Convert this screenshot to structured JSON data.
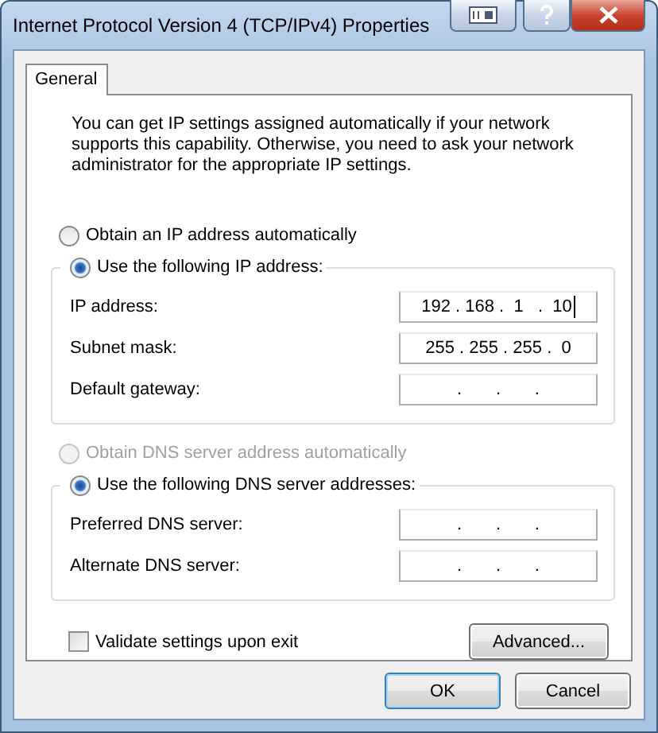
{
  "window": {
    "title": "Internet Protocol Version 4 (TCP/IPv4) Properties"
  },
  "tabs": [
    {
      "label": "General",
      "selected": true
    }
  ],
  "description": "You can get IP settings assigned automatically if your network supports this capability. Otherwise, you need to ask your network administrator for the appropriate IP settings.",
  "ip_mode": [
    {
      "label": "Obtain an IP address automatically",
      "selected": false,
      "disabled": false
    },
    {
      "label": "Use the following IP address:",
      "selected": true,
      "disabled": false
    }
  ],
  "ip_fields": [
    {
      "label": "IP address:",
      "value": "192 . 168 .  1   .  10",
      "caret": true
    },
    {
      "label": "Subnet mask:",
      "value": "255 . 255 . 255 .  0",
      "caret": false
    },
    {
      "label": "Default gateway:",
      "value": ".       .       .",
      "caret": false
    }
  ],
  "dns_mode": [
    {
      "label": "Obtain DNS server address automatically",
      "selected": false,
      "disabled": true
    },
    {
      "label": "Use the following DNS server addresses:",
      "selected": true,
      "disabled": false
    }
  ],
  "dns_fields": [
    {
      "label": "Preferred DNS server:",
      "value": ".       .       .",
      "caret": false
    },
    {
      "label": "Alternate DNS server:",
      "value": ".       .       .",
      "caret": false
    }
  ],
  "validate": {
    "label": "Validate settings upon exit",
    "checked": false
  },
  "advanced_button": "Advanced...",
  "buttons": [
    {
      "label": "OK",
      "default": true
    },
    {
      "label": "Cancel",
      "default": false
    }
  ]
}
